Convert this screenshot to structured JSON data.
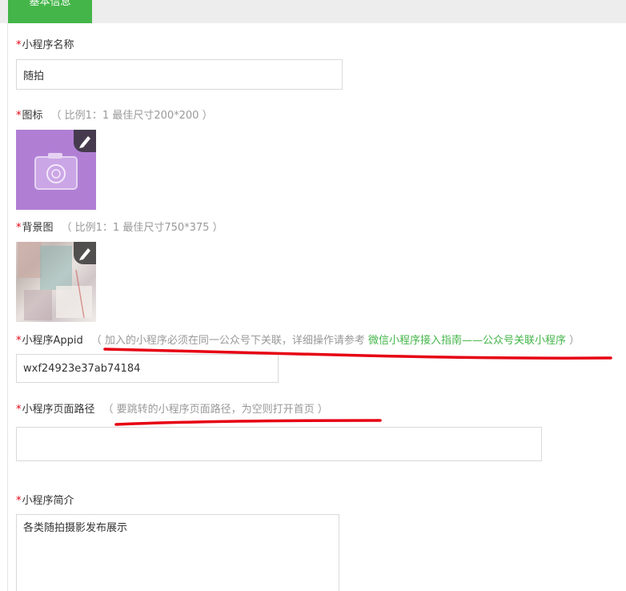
{
  "tabs": {
    "active_label": "基本信息"
  },
  "fields": {
    "name": {
      "required_mark": "*",
      "label": "小程序名称",
      "value": "随拍"
    },
    "icon": {
      "required_mark": "*",
      "label": "图标",
      "hint": "（ 比例1：1 最佳尺寸200*200 ）",
      "image": "camera-icon-image"
    },
    "background": {
      "required_mark": "*",
      "label": "背景图",
      "hint": "（ 比例1：1 最佳尺寸750*375 ）",
      "image": "background-photo"
    },
    "appid": {
      "required_mark": "*",
      "label": "小程序Appid",
      "hint_prefix": "（ 加入的小程序必须在同一公众号下关联，详细操作请参考 ",
      "hint_link": "微信小程序接入指南——公众号关联小程序",
      "hint_suffix": " ）",
      "value": "wxf24923e37ab74184"
    },
    "path": {
      "required_mark": "*",
      "label": "小程序页面路径",
      "hint": "（ 要跳转的小程序页面路径，为空则打开首页 ）",
      "value": ""
    },
    "intro": {
      "required_mark": "*",
      "label": "小程序简介",
      "value": "各类随拍摄影发布展示"
    }
  },
  "icons": {
    "edit": "pencil-edit-icon"
  },
  "colors": {
    "accent": "#44b549",
    "required": "#e60012",
    "hint": "#999999",
    "annotation": "#e60012"
  }
}
